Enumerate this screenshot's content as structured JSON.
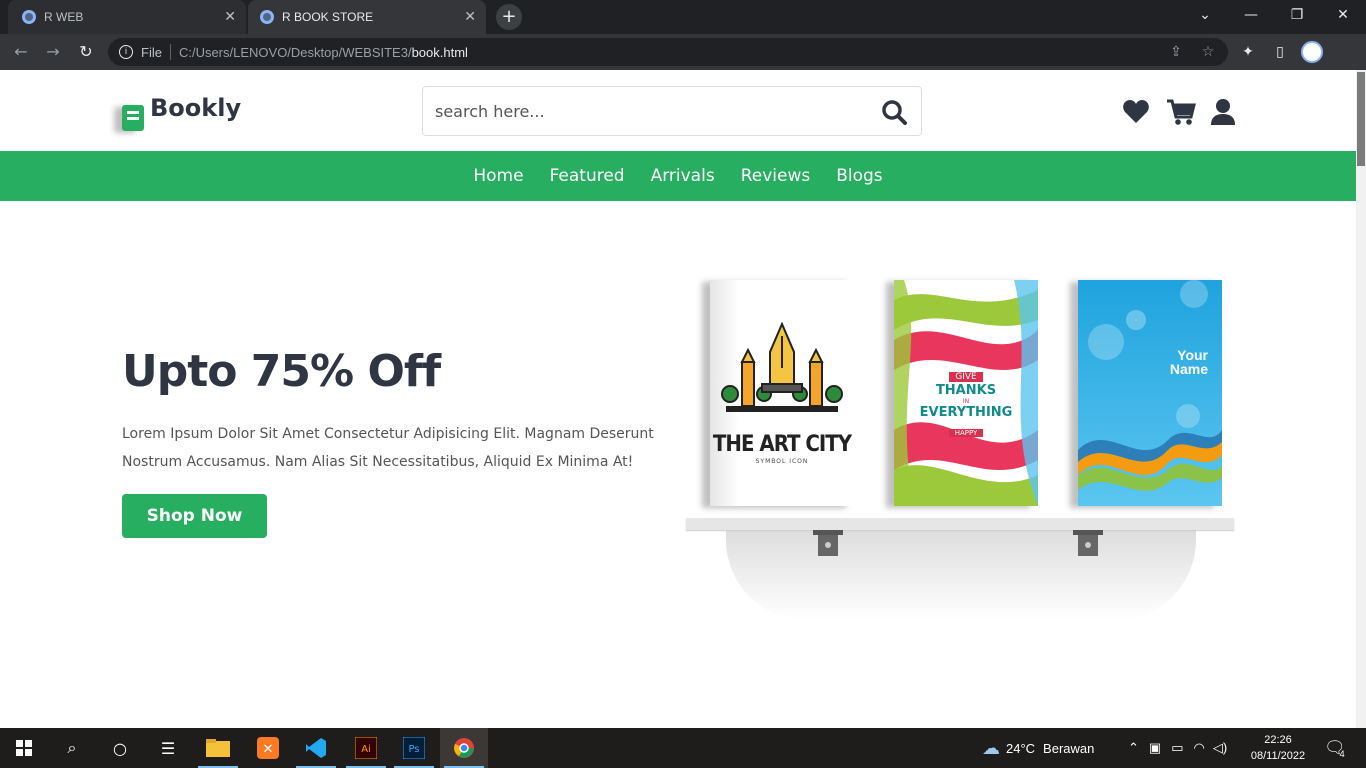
{
  "browser": {
    "tabs": [
      {
        "label": "R WEB",
        "active": false
      },
      {
        "label": "R BOOK STORE",
        "active": true
      }
    ],
    "address": {
      "scheme_label": "File",
      "url_prefix": "C:/Users/LENOVO/Desktop/WEBSITE3/",
      "url_file": "book.html"
    }
  },
  "site": {
    "logo_text": "Bookly",
    "search_placeholder": "search here...",
    "nav": [
      "Home",
      "Featured",
      "Arrivals",
      "Reviews",
      "Blogs"
    ],
    "hero": {
      "title": "Upto 75% Off",
      "text": "Lorem Ipsum Dolor Sit Amet Consectetur Adipisicing Elit. Magnam Deserunt Nostrum Accusamus. Nam Alias Sit Necessitatibus, Aliquid Ex Minima At!",
      "button": "Shop Now"
    },
    "books": [
      {
        "title": "THE ART CITY",
        "subtitle": "SYMBOL ICON"
      },
      {
        "lines": [
          "GIVE",
          "THANKS",
          "IN",
          "EVERYTHING",
          "HAPPY"
        ]
      },
      {
        "lines": [
          "Your",
          "Name"
        ]
      }
    ]
  },
  "taskbar": {
    "weather_temp": "24°C",
    "weather_desc": "Berawan",
    "time": "22:26",
    "date": "08/11/2022",
    "notifications": "4"
  },
  "colors": {
    "accent": "#27ae60",
    "text_dark": "#2f3542"
  }
}
